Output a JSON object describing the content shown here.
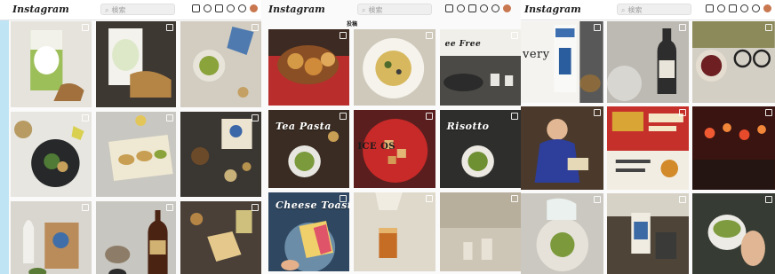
{
  "pages": [
    {
      "logo": "Instagram",
      "search_placeholder": "検索",
      "tiles": [
        {
          "caption": "",
          "subject": "green-package-dashi"
        },
        {
          "caption": "",
          "subject": "package-with-snacks"
        },
        {
          "caption": "",
          "subject": "green-tea-bowl"
        },
        {
          "caption": "",
          "subject": "tea-leaves-bowl"
        },
        {
          "caption": "",
          "subject": "snacks-on-tray"
        },
        {
          "caption": "",
          "subject": "tea-box-on-wood"
        },
        {
          "caption": "",
          "subject": "sake-jug-and-package"
        },
        {
          "caption": "",
          "subject": "soy-sauce-bottle"
        },
        {
          "caption": "",
          "subject": "wooden-masu-cup"
        }
      ]
    },
    {
      "logo": "Instagram",
      "search_placeholder": "検索",
      "tabs": [
        "投稿",
        "",
        ""
      ],
      "tiles": [
        {
          "caption": "",
          "subject": "fried-food-red-cloth"
        },
        {
          "caption": "",
          "subject": "pasta-plate"
        },
        {
          "caption": "ee Free",
          "subject": "pan-and-cups"
        },
        {
          "caption": "Tea Pasta",
          "subject": "tea-pasta"
        },
        {
          "caption": "ICE OS",
          "subject": "red-plate-croutons"
        },
        {
          "caption": "Risotto",
          "subject": "risotto"
        },
        {
          "caption": "Cheese Toast",
          "subject": "cheese-toast"
        },
        {
          "caption": "",
          "subject": "tea-pour-glass"
        },
        {
          "caption": "",
          "subject": "glasses-on-table"
        }
      ]
    },
    {
      "logo": "Instagram",
      "search_placeholder": "検索",
      "tiles": [
        {
          "caption": "very",
          "subject": "tea-package-and-cup"
        },
        {
          "caption": "",
          "subject": "bottle-on-marble"
        },
        {
          "caption": "",
          "subject": "tea-cup-and-glasses"
        },
        {
          "caption": "",
          "subject": "person-blue-shirt"
        },
        {
          "caption": "",
          "subject": "event-poster"
        },
        {
          "caption": "",
          "subject": "night-street"
        },
        {
          "caption": "",
          "subject": "teapot-and-dish"
        },
        {
          "caption": "",
          "subject": "tea-canister"
        },
        {
          "caption": "",
          "subject": "hands-holding-cup"
        }
      ]
    }
  ],
  "colors": {
    "accent_strip": "#bfe5f4",
    "page_background": "#fafafa",
    "topbar": "#ffffff"
  },
  "icons": [
    "home-icon",
    "compass-icon",
    "add-icon",
    "explore-icon",
    "heart-icon",
    "avatar"
  ]
}
